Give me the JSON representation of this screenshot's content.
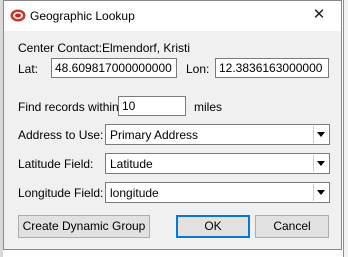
{
  "dialog": {
    "title": "Geographic Lookup",
    "close_glyph": "✕"
  },
  "center_contact": {
    "label": "Center Contact:",
    "name": "Elmendorf, Kristi"
  },
  "lat": {
    "label": "Lat:",
    "value": "48.609817000000000"
  },
  "lon": {
    "label": "Lon:",
    "value": "12.3836163000000"
  },
  "radius": {
    "label": "Find records within",
    "value": "10",
    "unit": "miles"
  },
  "address": {
    "label": "Address to Use:",
    "selected": "Primary Address"
  },
  "latitude_field": {
    "label": "Latitude Field:",
    "selected": "Latitude"
  },
  "longitude_field": {
    "label": "Longitude Field:",
    "selected": "longitude"
  },
  "buttons": {
    "create_group": "Create Dynamic Group",
    "ok": "OK",
    "cancel": "Cancel"
  },
  "colors": {
    "default_button_border": "#0078d7",
    "dialog_bg": "#f0f0f0"
  },
  "icons": {
    "app": "app-logo-icon",
    "dropdown": "chevron-down-icon"
  }
}
